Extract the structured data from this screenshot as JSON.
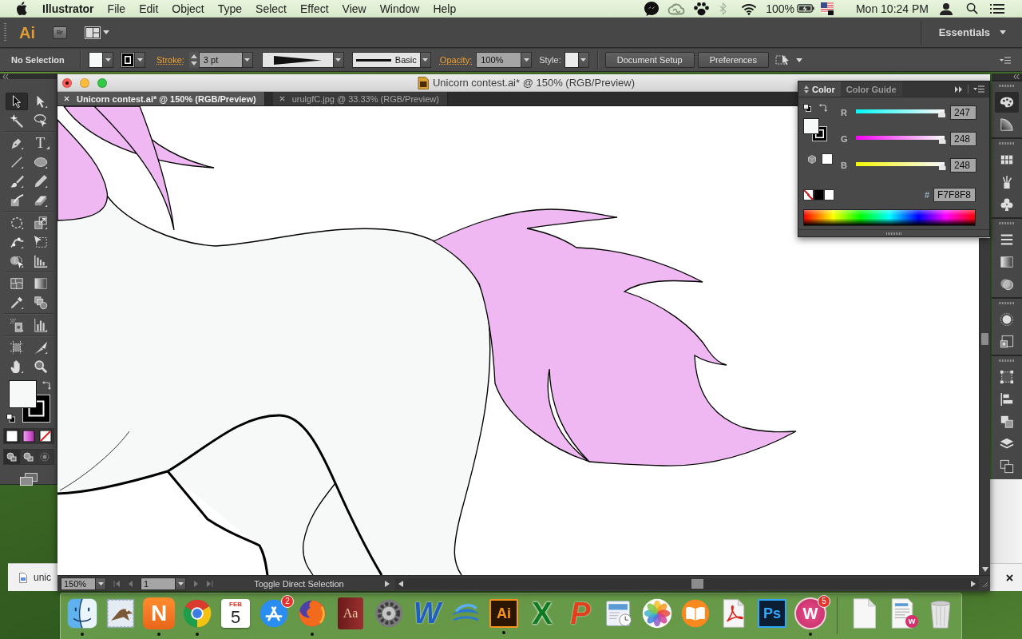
{
  "menu_bar": {
    "app": "Illustrator",
    "menus": [
      "File",
      "Edit",
      "Object",
      "Type",
      "Select",
      "Effect",
      "View",
      "Window",
      "Help"
    ],
    "battery": "100%",
    "clock": "Mon 10:24 PM"
  },
  "app_bar": {
    "logo": "Ai",
    "bridge_button": "Br",
    "workspace": "Essentials"
  },
  "control_bar": {
    "selection": "No Selection",
    "stroke_label": "Stroke:",
    "stroke_weight": "3 pt",
    "stroke_style": "Basic",
    "opacity_label": "Opacity:",
    "opacity": "100%",
    "style_label": "Style:",
    "buttons": [
      "Document Setup",
      "Preferences"
    ]
  },
  "tools_panel": {
    "groups": [
      {
        "tools": [
          {
            "selected": true
          },
          {
            "selected": false
          },
          {
            "selected": false
          },
          {
            "selected": false
          }
        ]
      },
      {
        "tools": [
          {
            "selected": false
          },
          {
            "selected": false,
            "glyph": "T"
          },
          {
            "selected": false
          },
          {
            "selected": false
          },
          {
            "selected": false
          },
          {
            "selected": false
          },
          {
            "selected": false
          },
          {
            "selected": false
          }
        ]
      },
      {
        "tools": [
          {
            "selected": false
          },
          {
            "selected": false
          },
          {
            "selected": false
          },
          {
            "selected": false
          },
          {
            "selected": false
          },
          {
            "selected": false
          }
        ]
      },
      {
        "tools": [
          {
            "selected": false
          },
          {
            "selected": false
          },
          {
            "selected": false
          },
          {
            "selected": false
          }
        ]
      },
      {
        "tools": [
          {
            "selected": false
          },
          {
            "selected": false
          }
        ]
      },
      {
        "tools": [
          {
            "selected": false
          },
          {
            "selected": false
          },
          {
            "selected": false
          },
          {
            "selected": false
          }
        ]
      }
    ]
  },
  "document": {
    "title": "Unicorn contest.ai* @ 150% (RGB/Preview)",
    "tabs": [
      {
        "label": "Unicorn contest.ai* @ 150% (RGB/Preview)",
        "selected": true
      },
      {
        "label": "urulgfC.jpg @ 33.33% (RGB/Preview)",
        "selected": false
      }
    ],
    "zoom": "150%",
    "artboard": "1",
    "status": "Toggle Direct Selection"
  },
  "color_panel": {
    "tabs": [
      {
        "label": "Color",
        "selected": true
      },
      {
        "label": "Color Guide",
        "selected": false
      }
    ],
    "channels": [
      {
        "name": "R",
        "level": 0.969,
        "value": "247"
      },
      {
        "name": "G",
        "level": 0.973,
        "value": "248"
      },
      {
        "name": "B",
        "level": 0.973,
        "value": "248"
      }
    ],
    "hex_label": "#",
    "hex": "F7F8F8"
  },
  "panel_dock": {
    "groups": [
      {
        "items": [
          {
            "selected": true
          },
          {
            "selected": false
          }
        ]
      },
      {
        "items": [
          {
            "selected": false
          },
          {
            "selected": false
          },
          {
            "selected": false
          }
        ]
      },
      {
        "items": [
          {
            "selected": false
          },
          {
            "selected": false
          },
          {
            "selected": false
          }
        ]
      },
      {
        "items": [
          {
            "selected": false
          },
          {
            "selected": false
          }
        ]
      },
      {
        "items": [
          {
            "selected": false
          },
          {
            "selected": false
          },
          {
            "selected": false
          },
          {
            "selected": false
          },
          {
            "selected": false
          }
        ]
      }
    ]
  },
  "download_shelf": {
    "file": "unic"
  },
  "dock": {
    "apps": [
      {
        "kind": "picture",
        "running": true
      },
      {
        "kind": "picture",
        "running": false
      },
      {
        "kind": "letter",
        "label": "N",
        "running": true
      },
      {
        "kind": "picture",
        "running": true
      },
      {
        "kind": "calendar",
        "month": "FEB",
        "day": "5",
        "running": false
      },
      {
        "kind": "picture",
        "badge": "2",
        "running": false
      },
      {
        "kind": "picture",
        "running": true
      },
      {
        "kind": "letter",
        "label": "Aa",
        "running": false
      },
      {
        "kind": "picture",
        "running": false
      },
      {
        "kind": "letter",
        "label": "W",
        "running": false
      },
      {
        "kind": "picture",
        "running": false
      },
      {
        "kind": "letter",
        "label": "Ai",
        "running": true
      },
      {
        "kind": "letter",
        "label": "X",
        "running": false
      },
      {
        "kind": "letter",
        "label": "P",
        "running": false
      },
      {
        "kind": "picture",
        "running": false
      },
      {
        "kind": "picture",
        "running": false
      },
      {
        "kind": "picture",
        "running": false
      },
      {
        "kind": "picture",
        "running": false
      },
      {
        "kind": "letter",
        "label": "Ps",
        "running": false
      },
      {
        "kind": "letter",
        "label": "W",
        "badge": "5",
        "running": true
      }
    ],
    "others": [
      {
        "kind": "picture"
      },
      {
        "kind": "picture",
        "badge": "w"
      },
      {
        "kind": "picture"
      }
    ]
  }
}
